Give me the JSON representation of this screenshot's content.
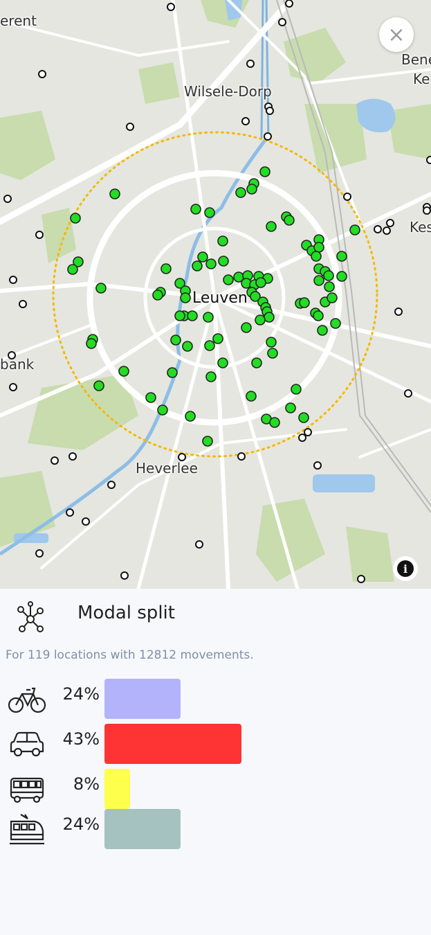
{
  "map": {
    "places": {
      "leuven": "Leuven",
      "wilsele": "Wilsele-Dorp",
      "heverlee": "Heverlee",
      "erent": "erent",
      "bank": "bank",
      "bene": "Bene",
      "ke": "Ke",
      "kes": "Kes"
    },
    "close_label": "×",
    "info_label": "i",
    "colors": {
      "marker": "#22dd22",
      "radius_ring": "#f5b800",
      "road": "#ffffff",
      "water": "#9fc8ec",
      "park": "#c8dcae"
    }
  },
  "panel": {
    "title": "Modal split",
    "summary": "For 119 locations with 12812 movements.",
    "rows": [
      {
        "mode": "bicycle",
        "icon": "bicycle-icon",
        "pct_label": "24%",
        "value": 24,
        "color": "#b3b3fb"
      },
      {
        "mode": "car",
        "icon": "car-icon",
        "pct_label": "43%",
        "value": 43,
        "color": "#fe3333"
      },
      {
        "mode": "bus",
        "icon": "bus-icon",
        "pct_label": "8%",
        "value": 8,
        "color": "#fefe4d"
      },
      {
        "mode": "train",
        "icon": "train-icon",
        "pct_label": "24%",
        "value": 24,
        "color": "#a5c2c0"
      }
    ]
  }
}
